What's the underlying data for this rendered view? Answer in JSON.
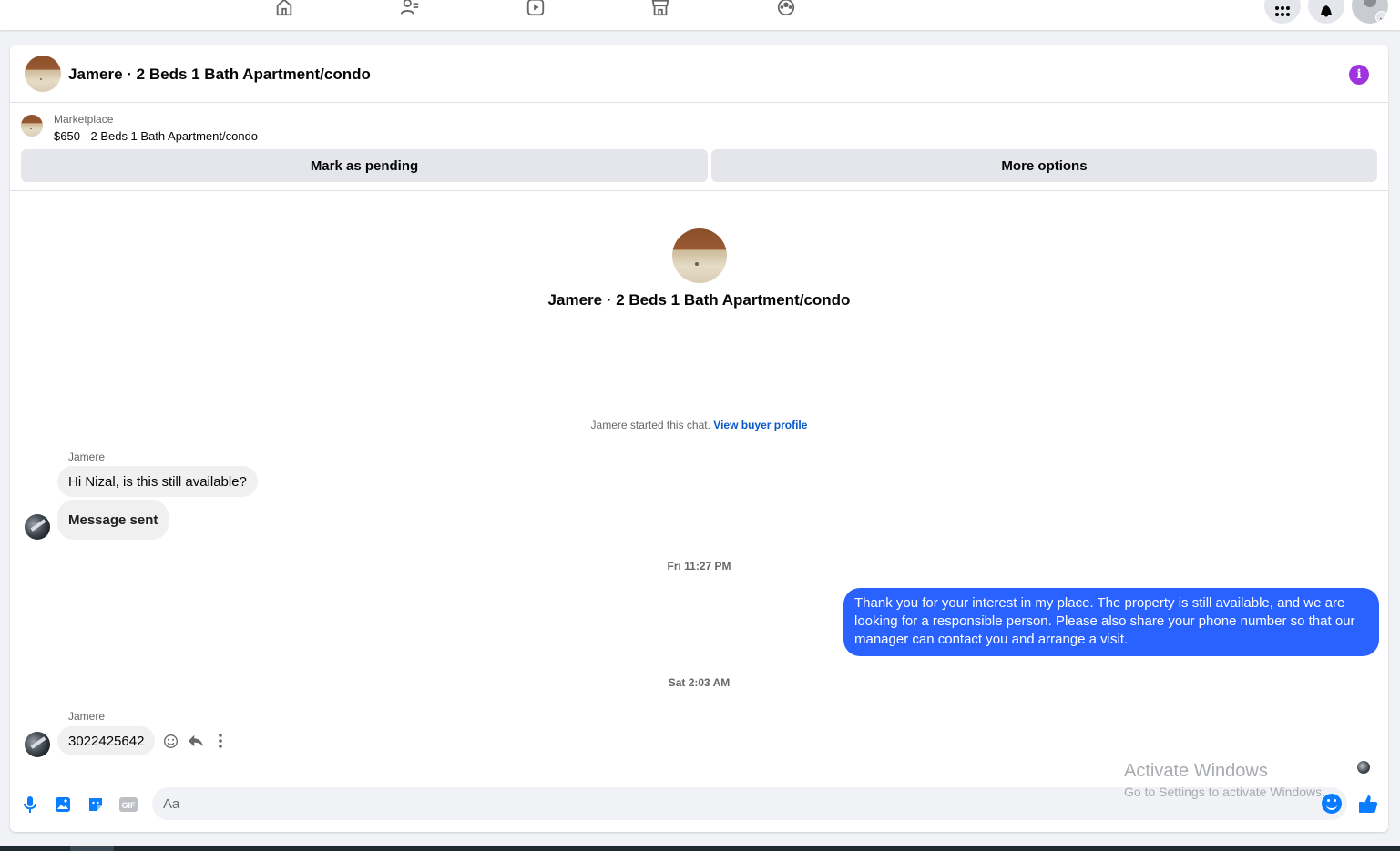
{
  "nav": {
    "icons": [
      "home-icon",
      "friends-icon",
      "watch-icon",
      "marketplace-icon",
      "groups-icon"
    ],
    "right_icons": [
      "menu-grid-icon",
      "notifications-icon",
      "account-icon"
    ]
  },
  "header": {
    "title": "Jamere · 2 Beds 1 Bath Apartment/condo",
    "info_icon": "info-icon",
    "info_glyph": "i",
    "accent": "#a033e0"
  },
  "listing": {
    "label": "Marketplace",
    "price_title": "$650 - 2 Beds 1 Bath Apartment/condo",
    "mark_pending": "Mark as pending",
    "more_options": "More options"
  },
  "intro": {
    "title": "Jamere · 2 Beds 1 Bath Apartment/condo",
    "started_text": "Jamere started this chat.",
    "view_profile": "View buyer profile"
  },
  "messages": {
    "sender1": "Jamere",
    "msg1": "Hi Nizal, is this still available?",
    "msg2": "Message sent",
    "time1": "Fri 11:27 PM",
    "outgoing": "Thank you for your interest in my place. The property is still available, and we are looking for a responsible person. Please also share your phone number so that our manager can contact you and arrange a visit.",
    "outgoing_color": "#2962ff",
    "time2": "Sat 2:03 AM",
    "sender2": "Jamere",
    "msg3": "3022425642"
  },
  "composer": {
    "placeholder": "Aa",
    "gif_label": "GIF",
    "icons": [
      "microphone-icon",
      "photo-icon",
      "sticker-icon",
      "gif-icon",
      "emoji-icon",
      "like-icon"
    ],
    "accent": "#0a7cff"
  },
  "watermark": {
    "line1": "Activate Windows",
    "line2": "Go to Settings to activate Windows."
  }
}
